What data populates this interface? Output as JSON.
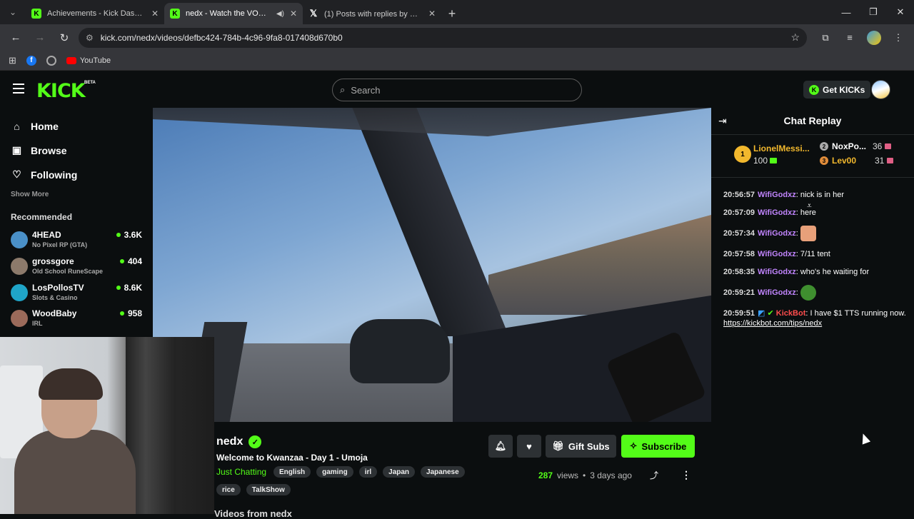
{
  "browser": {
    "tabs": [
      {
        "title": "Achievements - Kick Dashboard",
        "icon": "kick-icon",
        "active": false
      },
      {
        "title": "nedx - Watch the VOD on Kick",
        "icon": "kick-icon",
        "active": true
      },
      {
        "title": "(1) Posts with replies by ジョニー",
        "icon": "x-icon",
        "active": false
      }
    ],
    "url": "kick.com/nedx/videos/defbc424-784b-4c96-9fa8-017408d670b0",
    "bookmarks": {
      "youtube": "YouTube"
    }
  },
  "header": {
    "logo": "KICK",
    "beta": "BETA",
    "search_placeholder": "Search",
    "get_kicks": "Get KICKs"
  },
  "sidebar": {
    "nav": [
      {
        "label": "Home",
        "icon": "home-icon"
      },
      {
        "label": "Browse",
        "icon": "browse-icon"
      },
      {
        "label": "Following",
        "icon": "heart-icon"
      }
    ],
    "show_more": "Show More",
    "recommended_title": "Recommended",
    "recommended": [
      {
        "name": "4HEAD",
        "category": "No Pixel RP (GTA)",
        "viewers": "3.6K",
        "color": "#4a90c8"
      },
      {
        "name": "grossgore",
        "category": "Old School RuneScape",
        "viewers": "404",
        "color": "#8c7a6b"
      },
      {
        "name": "LosPollosTV",
        "category": "Slots & Casino",
        "viewers": "8.6K",
        "color": "#1fa5c8"
      },
      {
        "name": "WoodBaby",
        "category": "IRL",
        "viewers": "958",
        "color": "#9b6a5a"
      }
    ]
  },
  "video_info": {
    "channel": "nedx",
    "title": "Welcome to Kwanzaa - Day 1 - Umoja",
    "category": "Just Chatting",
    "tags_row1": [
      "English",
      "gaming",
      "irl",
      "Japan",
      "Japanese"
    ],
    "tags_row2": [
      "rice",
      "TalkShow"
    ],
    "gift_subs": "Gift Subs",
    "subscribe": "Subscribe",
    "views_count": "287",
    "views_label": "views",
    "dot": "•",
    "age": "3 days ago",
    "more_from": "Videos from nedx"
  },
  "chat": {
    "title": "Chat Replay",
    "leaderboard": {
      "first": {
        "name": "LionelMessi...",
        "score": "100"
      },
      "second": {
        "name": "NoxPo...",
        "count": "36"
      },
      "third": {
        "name": "Lev00",
        "count": "31"
      }
    },
    "messages": [
      {
        "time": "20:56:57",
        "user": "WifiGodxz",
        "text": "nick is in her"
      },
      {
        "time": "20:57:09",
        "user": "WifiGodxz",
        "text": "here"
      },
      {
        "time": "20:57:34",
        "user": "WifiGodxz",
        "text": ""
      },
      {
        "time": "20:57:58",
        "user": "WifiGodxz",
        "text": "7/11 tent"
      },
      {
        "time": "20:58:35",
        "user": "WifiGodxz",
        "text": "who's he waiting for"
      },
      {
        "time": "20:59:21",
        "user": "WifiGodxz",
        "text": ""
      },
      {
        "time": "20:59:51",
        "user": "KickBot",
        "text": "I have $1 TTS running now.",
        "link": "https://kickbot.com/tips/nedx"
      }
    ]
  },
  "colors": {
    "accent": "#53fc18",
    "chat_user": "#c084fc",
    "kickbot": "#ff4d4d",
    "gold": "#f2b82d"
  }
}
